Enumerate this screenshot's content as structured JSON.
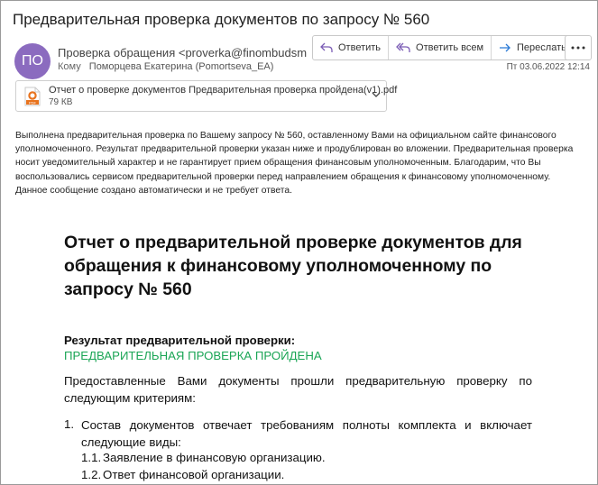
{
  "email": {
    "subject": "Предварительная проверка документов по запросу № 560",
    "avatar_initials": "ПО",
    "from": "Проверка обращения <proverka@finombudsm",
    "to_label": "Кому",
    "to": "Поморцева Екатерина (Pomortseva_EA)",
    "date": "Пт 03.06.2022 12:14",
    "colors": {
      "avatar": "#8b6bbf",
      "pass": "#1aa555",
      "action_icon": "#7b5cb5"
    }
  },
  "actions": {
    "reply": "Ответить",
    "reply_all": "Ответить всем",
    "forward": "Переслать",
    "more_icon": "ellipsis-icon"
  },
  "attachment": {
    "name": "Отчет о проверке документов Предварительная проверка пройдена(v1).pdf",
    "size": "79 КВ",
    "icon": "pdf-icon"
  },
  "body": {
    "intro": "Выполнена предварительная проверка по Вашему запросу № 560, оставленному Вами на официальном сайте финансового уполномоченного. Результат предварительной проверки указан ниже и продублирован во вложении. Предварительная проверка носит уведомительный характер и не гарантирует прием обращения финансовым уполномоченным. Благодарим, что Вы воспользовались сервисом предварительной проверки перед направлением обращения к финансовому уполномоченному. Данное сообщение создано автоматически и не требует ответа.",
    "report_title": "Отчет о предварительной  проверке документов для обращения к финансовому уполномоченному по запросу № 560",
    "result_label": "Результат предварительной проверки:",
    "result_value": "ПРЕДВАРИТЕЛЬНАЯ ПРОВЕРКА ПРОЙДЕНА",
    "criteria_intro": "Предоставленные Вами документы прошли предварительную проверку по следующим критериям:",
    "item1_num": "1.",
    "item1_text": "Состав документов отвечает требованиям полноты комплекта и включает следующие виды:",
    "sub_items": [
      {
        "num": "1.1.",
        "text": "Заявление в финансовую организацию."
      },
      {
        "num": "1.2.",
        "text": "Ответ финансовой организации."
      }
    ]
  }
}
